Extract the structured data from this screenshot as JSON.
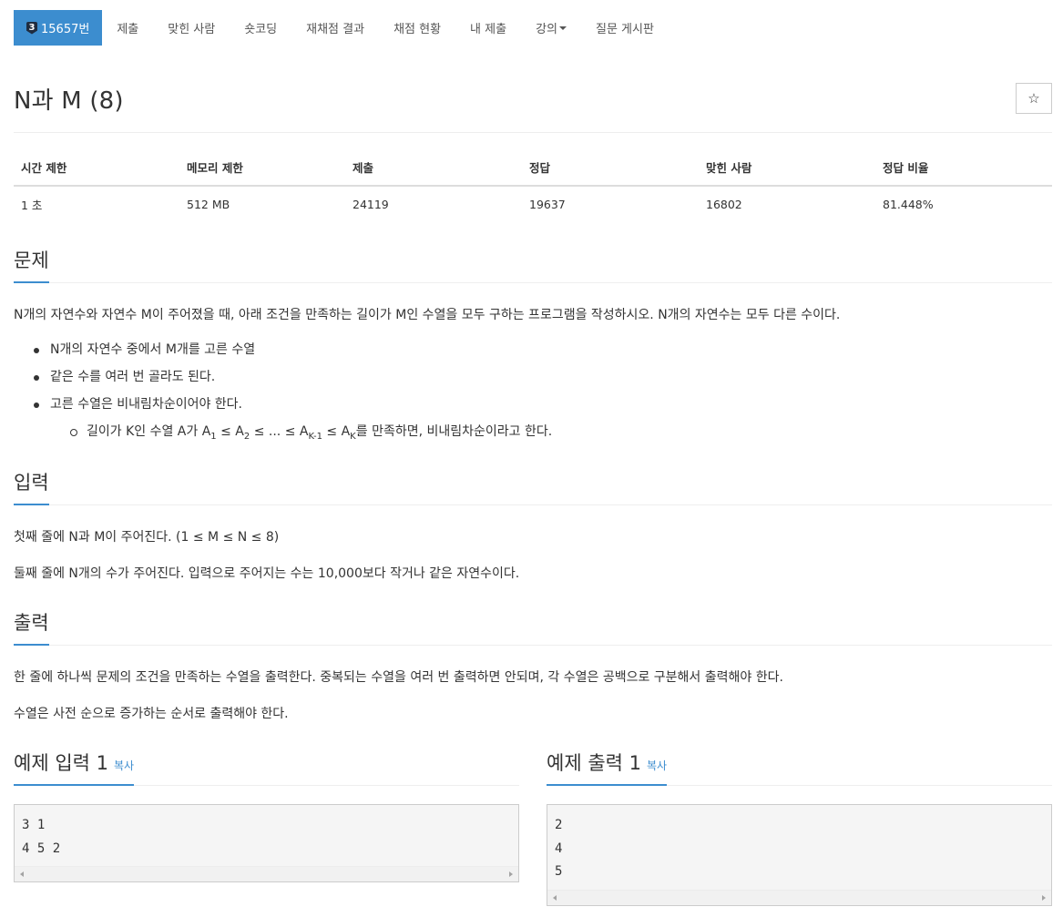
{
  "nav": {
    "problem_tier": "3",
    "problem_number": "15657번",
    "items": [
      "제출",
      "맞힌 사람",
      "숏코딩",
      "재채점 결과",
      "채점 현황",
      "내 제출",
      "강의",
      "질문 게시판"
    ]
  },
  "title": "N과 M (8)",
  "star_icon": "☆",
  "info": {
    "headers": [
      "시간 제한",
      "메모리 제한",
      "제출",
      "정답",
      "맞힌 사람",
      "정답 비율"
    ],
    "values": [
      "1 초",
      "512 MB",
      "24119",
      "19637",
      "16802",
      "81.448%"
    ]
  },
  "problem": {
    "heading": "문제",
    "intro": "N개의 자연수와 자연수 M이 주어졌을 때, 아래 조건을 만족하는 길이가 M인 수열을 모두 구하는 프로그램을 작성하시오. N개의 자연수는 모두 다른 수이다.",
    "conditions": [
      "N개의 자연수 중에서 M개를 고른 수열",
      "같은 수를 여러 번 골라도 된다.",
      "고른 수열은 비내림차순이어야 한다."
    ],
    "sub": {
      "lead": "길이가 K인 수열 A가 A",
      "s1": "1",
      "m1": " ≤ A",
      "s2": "2",
      "m2": " ≤ ... ≤ A",
      "s3": "K-1",
      "m3": " ≤ A",
      "s4": "K",
      "tail": "를 만족하면, 비내림차순이라고 한다."
    }
  },
  "input": {
    "heading": "입력",
    "lines": [
      "첫째 줄에 N과 M이 주어진다. (1 ≤ M ≤ N ≤ 8)",
      "둘째 줄에 N개의 수가 주어진다. 입력으로 주어지는 수는 10,000보다 작거나 같은 자연수이다."
    ]
  },
  "output": {
    "heading": "출력",
    "lines": [
      "한 줄에 하나씩 문제의 조건을 만족하는 수열을 출력한다. 중복되는 수열을 여러 번 출력하면 안되며, 각 수열은 공백으로 구분해서 출력해야 한다.",
      "수열은 사전 순으로 증가하는 순서로 출력해야 한다."
    ]
  },
  "samples": {
    "input_heading": "예제 입력 1",
    "output_heading": "예제 출력 1",
    "copy_label": "복사",
    "input_text": "3 1\n4 5 2",
    "output_text": "2\n4\n5"
  },
  "colors": {
    "accent": "#3c8dcf",
    "text": "#333333"
  }
}
